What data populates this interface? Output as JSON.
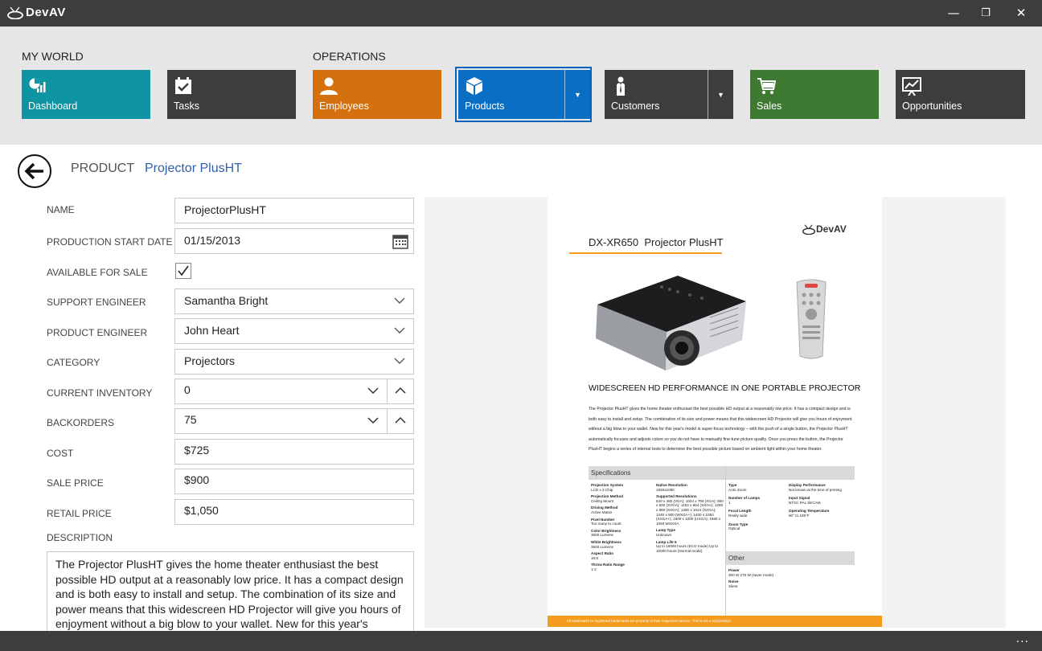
{
  "app": {
    "logo_text": "DevAV"
  },
  "window": {
    "minimize": "—",
    "restore": "❐",
    "close": "✕"
  },
  "ribbon": {
    "groups": [
      "MY WORLD",
      "OPERATIONS"
    ],
    "tiles": [
      {
        "label": "Dashboard",
        "color": "#0f94a3",
        "icon": "dashboard-icon"
      },
      {
        "label": "Tasks",
        "color": "#3d3d3d",
        "icon": "tasks-icon"
      },
      {
        "label": "Employees",
        "color": "#d4700e",
        "icon": "employees-icon"
      },
      {
        "label": "Products",
        "color": "#0a6fc4",
        "icon": "products-icon",
        "selected": true
      },
      {
        "label": "Customers",
        "color": "#3d3d3d",
        "icon": "customers-icon"
      },
      {
        "label": "Sales",
        "color": "#3f7a33",
        "icon": "sales-icon"
      },
      {
        "label": "Opportunities",
        "color": "#3d3d3d",
        "icon": "opportunities-icon"
      }
    ]
  },
  "breadcrumb": {
    "section": "PRODUCT",
    "item": "Projector PlusHT"
  },
  "form": {
    "name": {
      "label": "NAME",
      "value": "ProjectorPlusHT"
    },
    "production_start": {
      "label": "PRODUCTION START DATE",
      "value": "01/15/2013"
    },
    "available": {
      "label": "AVAILABLE FOR SALE",
      "checked": true
    },
    "support_engineer": {
      "label": "SUPPORT ENGINEER",
      "value": "Samantha Bright"
    },
    "product_engineer": {
      "label": "PRODUCT ENGINEER",
      "value": "John Heart"
    },
    "category": {
      "label": "CATEGORY",
      "value": "Projectors"
    },
    "current_inventory": {
      "label": "CURRENT INVENTORY",
      "value": "0"
    },
    "backorders": {
      "label": "BACKORDERS",
      "value": "75"
    },
    "cost": {
      "label": "COST",
      "value": "$725"
    },
    "sale_price": {
      "label": "SALE PRICE",
      "value": "$900"
    },
    "retail_price": {
      "label": "RETAIL PRICE",
      "value": "$1,050"
    },
    "description": {
      "label": "DESCRIPTION",
      "value": "The Projector PlusHT gives the home theater enthusiast the best possible HD output at a reasonably low price. It has a compact design and is both easy to install and setup. The combination of its size and power means that this widescreen HD Projector will give you hours of enjoyment without a big blow to your wallet.  New for this year's"
    }
  },
  "brochure": {
    "model": "DX-XR650",
    "name": "Projector PlusHT",
    "logo_text": "DevAV",
    "headline": "WIDESCREEN HD PERFORMANCE IN ONE PORTABLE PROJECTOR",
    "body": "The Projector PlusHT gives the home theater enthusiast the best possible HD output at a reasonably low price. It has a compact design and is both easy to install and setup. The combination of its size and power means that this widescreen HD Projector will give you hours of enjoyment without a big blow to your wallet.  New for this year's model is super-focus technology – with the push of a single button, the Projector PlusHT automatically focuses and adjusts colors so you do not have to manually fine-tune picture quality. Once you press the button, the Projector PlusHT begins a series of internal tests to determine the best possible picture based on ambient light within your home theater.",
    "spec_header": "Specifications",
    "other_header": "Other",
    "specs_col1": [
      {
        "k": "Projection System",
        "v": "LCD x 3 Chip"
      },
      {
        "k": "Projection Method",
        "v": "Ceiling Mount"
      },
      {
        "k": "Driving Method",
        "v": "Active Matrix"
      },
      {
        "k": "Pixel Number",
        "v": "Too many to count"
      },
      {
        "k": "Color Brightness",
        "v": "3500 Lumens"
      },
      {
        "k": "White Brightness",
        "v": "3500 Lumens"
      },
      {
        "k": "Aspect Ratio",
        "v": "16:9"
      },
      {
        "k": "Throw Ratio Range",
        "v": "1-2"
      }
    ],
    "specs_col2": [
      {
        "k": "Native Resolution",
        "v": "1920x1080"
      },
      {
        "k": "Supported Resolutions",
        "v": "640 x 480 (VGA); 1024 x 768 (XGA); 800 x 600 (SVGA); 1152 x 864 (SXGA); 1280 x 960 (SXGA); 1280 x 1024 (SXGA); 1440 x 900 (WXGA+); 1400 x 1050 (SXGA+); 1600 x 1200 (UXGA); 1680 x 1050 WSXGA"
      },
      {
        "k": "Lamp Type",
        "v": "Unknown"
      },
      {
        "k": "Lamp Life 5",
        "v": "Up to 16000 hours (ECO mode) Up to 10000 hours (Normal mode)"
      }
    ],
    "specs_col3": [
      {
        "k": "Type",
        "v": "Auto Zoom"
      },
      {
        "k": "Number of Lamps",
        "v": "1"
      },
      {
        "k": "Focal Length",
        "v": "Really wide"
      },
      {
        "k": "Zoom Type",
        "v": "Optical"
      }
    ],
    "specs_col4": [
      {
        "k": "Display Performance",
        "v": "Not known at the time of printing"
      },
      {
        "k": "Input Signal",
        "v": "NTSC PAL SECAM"
      },
      {
        "k": "Operating Temperature",
        "v": "90° to 105°F"
      }
    ],
    "other": [
      {
        "k": "Power",
        "v": "300 W 275 W (saver mode)"
      },
      {
        "k": "Noise",
        "v": "Silent"
      }
    ],
    "footer": "All trademarks or registered trademarks are property of their respective owners. This is not a real product."
  },
  "bottom": {
    "more": "..."
  },
  "colors": {
    "accent_orange": "#f39c1e",
    "link_blue": "#2d5fa8"
  }
}
